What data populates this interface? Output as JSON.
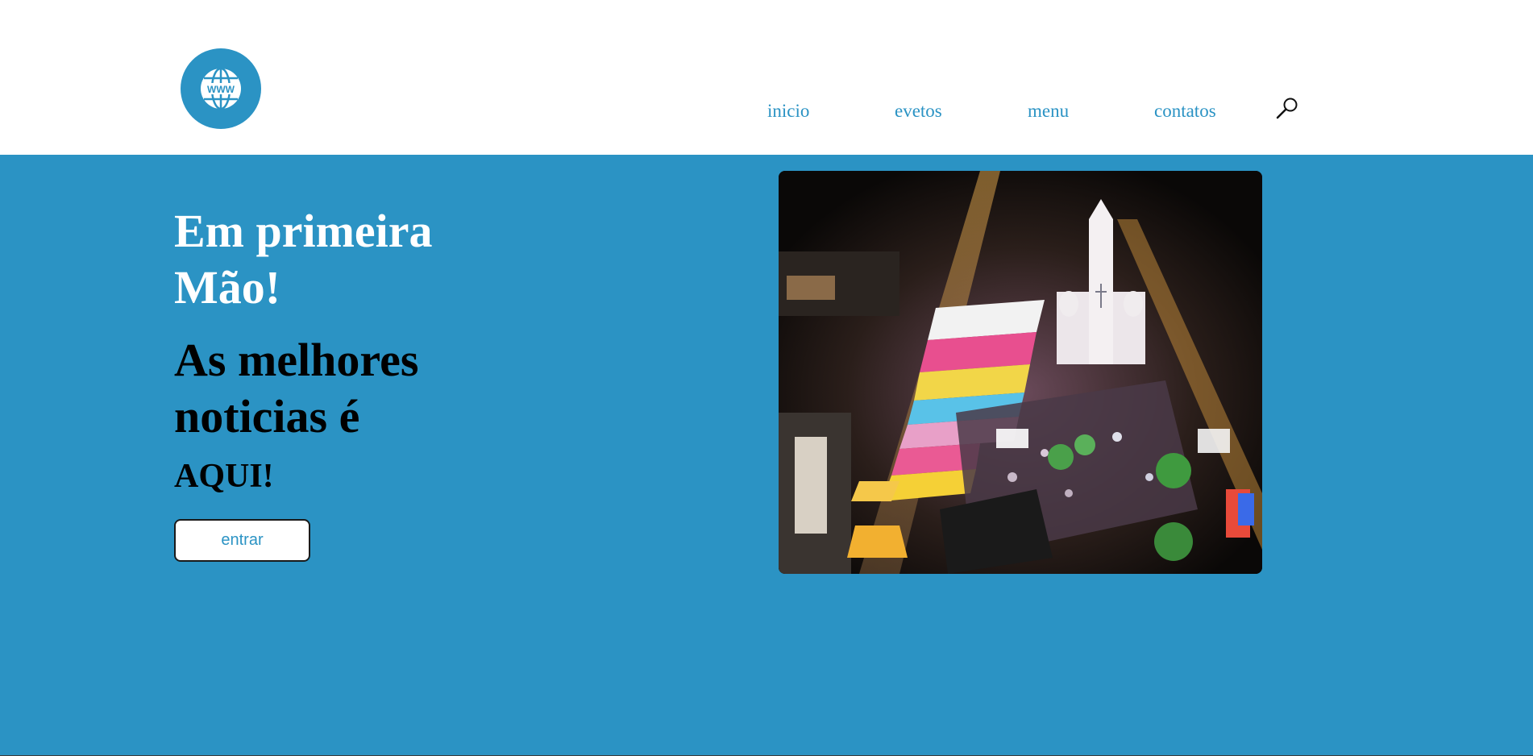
{
  "header": {
    "logo_icon": "globe-www-icon",
    "logo_text": "WWW",
    "nav": [
      {
        "label": "inicio"
      },
      {
        "label": "evetos"
      },
      {
        "label": "menu"
      },
      {
        "label": "contatos"
      }
    ],
    "search_icon": "magnifier-icon"
  },
  "hero": {
    "title": "Em primeira Mão!",
    "subtitle": "As melhores noticias é",
    "highlight": "AQUI!",
    "button_label": "entrar",
    "image_icon": "aerial-night-festival-photo"
  },
  "colors": {
    "brand_blue": "#2b93c4",
    "background": "#ffffff",
    "text_dark": "#000000"
  }
}
